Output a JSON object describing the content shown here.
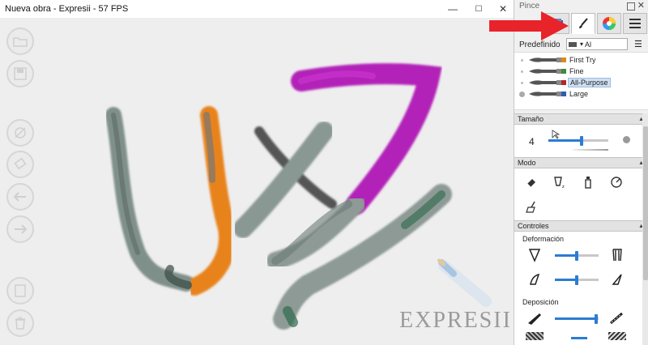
{
  "window": {
    "title": "Nueva obra - Expresii - 57 FPS",
    "min_glyph": "—",
    "max_glyph": "☐",
    "close_glyph": "✕"
  },
  "left_toolbar": [
    {
      "name": "open-icon"
    },
    {
      "name": "save-icon"
    },
    {
      "name": "view-rotate-icon"
    },
    {
      "name": "eraser-icon"
    },
    {
      "name": "undo-icon"
    },
    {
      "name": "redo-icon"
    },
    {
      "name": "layers-icon"
    },
    {
      "name": "trash-icon"
    }
  ],
  "watermark": "EXPRESII",
  "panel": {
    "title": "Pince",
    "close_glyph": "✕",
    "tabs": [
      {
        "name": "tab-paper",
        "icon": "paper-icon"
      },
      {
        "name": "tab-brush",
        "icon": "brush-icon",
        "active": true
      },
      {
        "name": "tab-color",
        "icon": "color-wheel-icon"
      },
      {
        "name": "tab-menu",
        "icon": "menu-icon"
      }
    ],
    "preset_label": "Predefinido",
    "preset_select_value": "Al",
    "presets": [
      {
        "name": "First Try",
        "color": "#d98a1a",
        "selected": false
      },
      {
        "name": "Fine",
        "color": "#3f8b3a",
        "selected": false
      },
      {
        "name": "All-Purpose",
        "color": "#b3262b",
        "selected": true
      },
      {
        "name": "Large",
        "color": "#2f5fb0",
        "selected": false
      }
    ],
    "size": {
      "header": "Tamaño",
      "value": "4",
      "slider_fraction": 0.55
    },
    "mode": {
      "header": "Modo",
      "icons": [
        "eraser-mode-icon",
        "dip-mode-icon",
        "spray-mode-icon",
        "blend-mode-icon",
        "sweep-mode-icon"
      ]
    },
    "controls": {
      "header": "Controles",
      "deformation_label": "Deformación",
      "deformation_slider_1": 0.5,
      "deformation_slider_2": 0.5,
      "deposition_label": "Deposición",
      "deposition_slider_1": 0.95
    },
    "colors": {
      "accent": "#2b7cd3",
      "selection": "#cfe0f2",
      "arrow": "#e8232a"
    }
  }
}
